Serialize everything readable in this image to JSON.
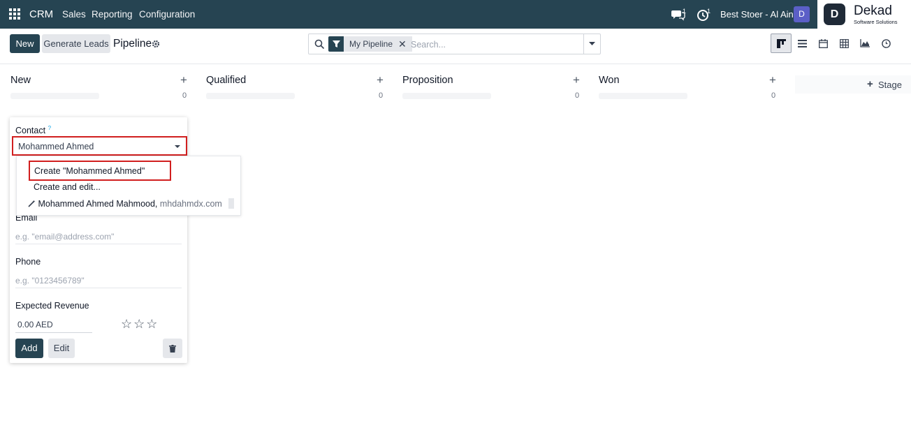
{
  "navbar": {
    "app_name": "CRM",
    "menu": [
      "Sales",
      "Reporting",
      "Configuration"
    ],
    "chat_count": "1",
    "activity_count": "1",
    "company": "Best Stoer - Al Ain",
    "avatar_initial": "D",
    "logo_mark": "D",
    "logo_name": "Dekad",
    "logo_tagline": "Software Solutions"
  },
  "control_panel": {
    "new_label": "New",
    "generate_leads_label": "Generate Leads",
    "title": "Pipeline",
    "facet_label": "My Pipeline",
    "search_placeholder": "Search...",
    "views": [
      "kanban",
      "list",
      "calendar",
      "pivot",
      "graph",
      "activity"
    ],
    "active_view": "kanban"
  },
  "kanban": {
    "columns": [
      {
        "name": "New",
        "count": "0"
      },
      {
        "name": "Qualified",
        "count": "0"
      },
      {
        "name": "Proposition",
        "count": "0"
      },
      {
        "name": "Won",
        "count": "0"
      }
    ],
    "add_stage_label": "Stage"
  },
  "quick_create": {
    "contact_label": "Contact",
    "contact_help": "?",
    "contact_value": "Mohammed Ahmed",
    "email_label": "Email",
    "email_placeholder": "e.g. \"email@address.com\"",
    "phone_label": "Phone",
    "phone_placeholder": "e.g. \"0123456789\"",
    "revenue_label": "Expected Revenue",
    "revenue_value": "0.00 AED",
    "priority_stars": 0,
    "add_label": "Add",
    "edit_label": "Edit"
  },
  "autocomplete": {
    "create_option": "Create \"Mohammed Ahmed\"",
    "create_edit_option": "Create and edit...",
    "suggestion_name": "Mohammed Ahmed Mahmood,",
    "suggestion_email": "mhdahmdx.com"
  },
  "colors": {
    "navbar": "#264452",
    "primary": "#264452",
    "highlight": "#d11f1f",
    "avatar": "#5b5fc7"
  }
}
